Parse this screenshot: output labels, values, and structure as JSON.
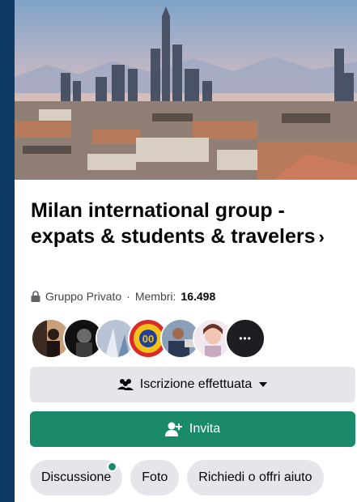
{
  "group": {
    "name": "Milan international group - expats & students & travelers",
    "chevron": "›",
    "privacy": "Gruppo Privato",
    "separator": "·",
    "members_label": "Membri:",
    "members_count": "16.498"
  },
  "members_preview": {
    "more_label": "•••"
  },
  "buttons": {
    "joined_label": "Iscrizione effettuata",
    "invite_label": "Invita"
  },
  "tabs": [
    {
      "label": "Discussione",
      "has_notification": true
    },
    {
      "label": "Foto",
      "has_notification": false
    },
    {
      "label": "Richiedi o offri aiuto",
      "has_notification": false
    }
  ],
  "colors": {
    "background": "#0e3a63",
    "accent": "#1b8a6b",
    "button_gray": "#e4e6eb"
  },
  "icons": {
    "lock": "lock-icon",
    "group": "group-icon",
    "dropdown": "caret-down-icon",
    "add_user": "add-user-icon"
  }
}
